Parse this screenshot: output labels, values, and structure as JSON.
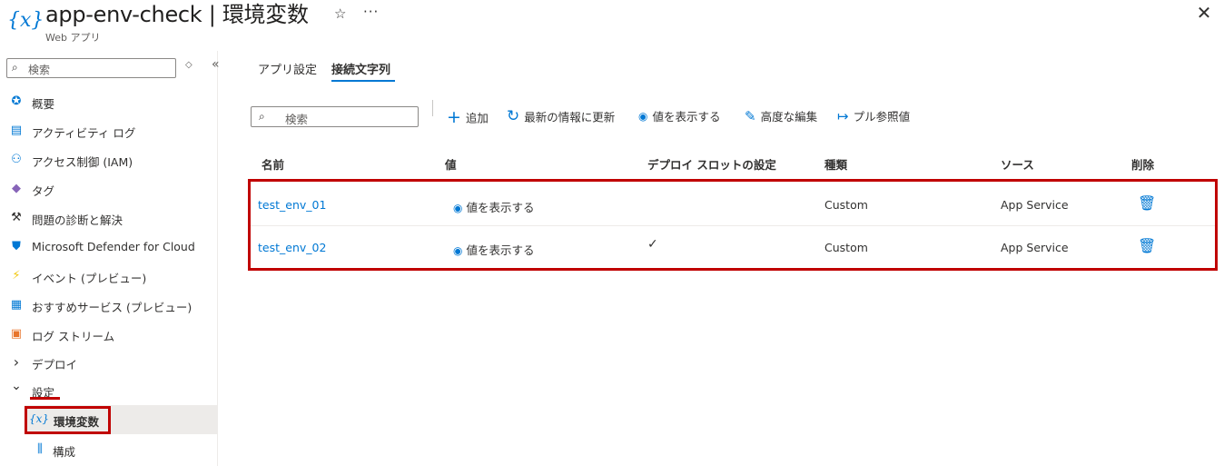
{
  "header": {
    "logo_glyph": "{x}",
    "title": "app-env-check | 環境変数",
    "subtitle": "Web アプリ",
    "star_glyph": "☆",
    "more_glyph": "···",
    "close_glyph": "✕"
  },
  "sidebar": {
    "search_placeholder": "検索",
    "search_icon": "⌕",
    "collapse_glyph": "«",
    "sort_glyph": "◇",
    "items": [
      {
        "label": "概要",
        "icon": "globe-icon",
        "glyph": "✪",
        "color": "#0078d4"
      },
      {
        "label": "アクティビティ ログ",
        "icon": "log-icon",
        "glyph": "▤",
        "color": "#0078d4"
      },
      {
        "label": "アクセス制御 (IAM)",
        "icon": "people-icon",
        "glyph": "⚇",
        "color": "#0078d4"
      },
      {
        "label": "タグ",
        "icon": "tag-icon",
        "glyph": "◆",
        "color": "#8764b8"
      },
      {
        "label": "問題の診断と解決",
        "icon": "wrench-icon",
        "glyph": "⚒",
        "color": "#323130"
      },
      {
        "label": "Microsoft Defender for Cloud",
        "icon": "shield-icon",
        "glyph": "⛊",
        "color": "#0078d4"
      },
      {
        "label": "イベント (プレビュー)",
        "icon": "lightning-icon",
        "glyph": "⚡",
        "color": "#f2c80f"
      },
      {
        "label": "おすすめサービス (プレビュー)",
        "icon": "grid-icon",
        "glyph": "▦",
        "color": "#0078d4"
      },
      {
        "label": "ログ ストリーム",
        "icon": "stream-icon",
        "glyph": "▣",
        "color": "#e8742b"
      },
      {
        "label": "デプロイ",
        "icon": "chevron-right-icon",
        "glyph": "›",
        "color": "#323130"
      },
      {
        "label": "設定",
        "icon": "chevron-down-icon",
        "glyph": "⌄",
        "color": "#323130"
      },
      {
        "label": "環境変数",
        "icon": "variable-icon",
        "glyph": "{x}",
        "color": "#0078d4"
      },
      {
        "label": "構成",
        "icon": "sliders-icon",
        "glyph": "⫼",
        "color": "#0078d4"
      }
    ]
  },
  "tabs": [
    {
      "label": "アプリ設定"
    },
    {
      "label": "接続文字列"
    }
  ],
  "toolbar": {
    "search_placeholder": "検索",
    "search_icon": "⌕",
    "add": "追加",
    "add_glyph": "+",
    "refresh": "最新の情報に更新",
    "refresh_glyph": "↻",
    "show_values": "値を表示する",
    "show_glyph": "◉",
    "advanced_edit": "高度な編集",
    "edit_glyph": "✎",
    "pull_refs": "プル参照値",
    "pull_glyph": "↦"
  },
  "table": {
    "headers": [
      "名前",
      "値",
      "デプロイ スロットの設定",
      "種類",
      "ソース",
      "削除"
    ],
    "rows": [
      {
        "name": "test_env_01",
        "value": "値を表示する",
        "slot": "",
        "kind": "Custom",
        "source": "App Service"
      },
      {
        "name": "test_env_02",
        "value": "値を表示する",
        "slot": "✓",
        "kind": "Custom",
        "source": "App Service"
      }
    ],
    "eye_glyph": "◉",
    "delete_glyph": "🗑"
  },
  "colors": {
    "accent": "#0078d4",
    "highlight": "#c00000"
  }
}
